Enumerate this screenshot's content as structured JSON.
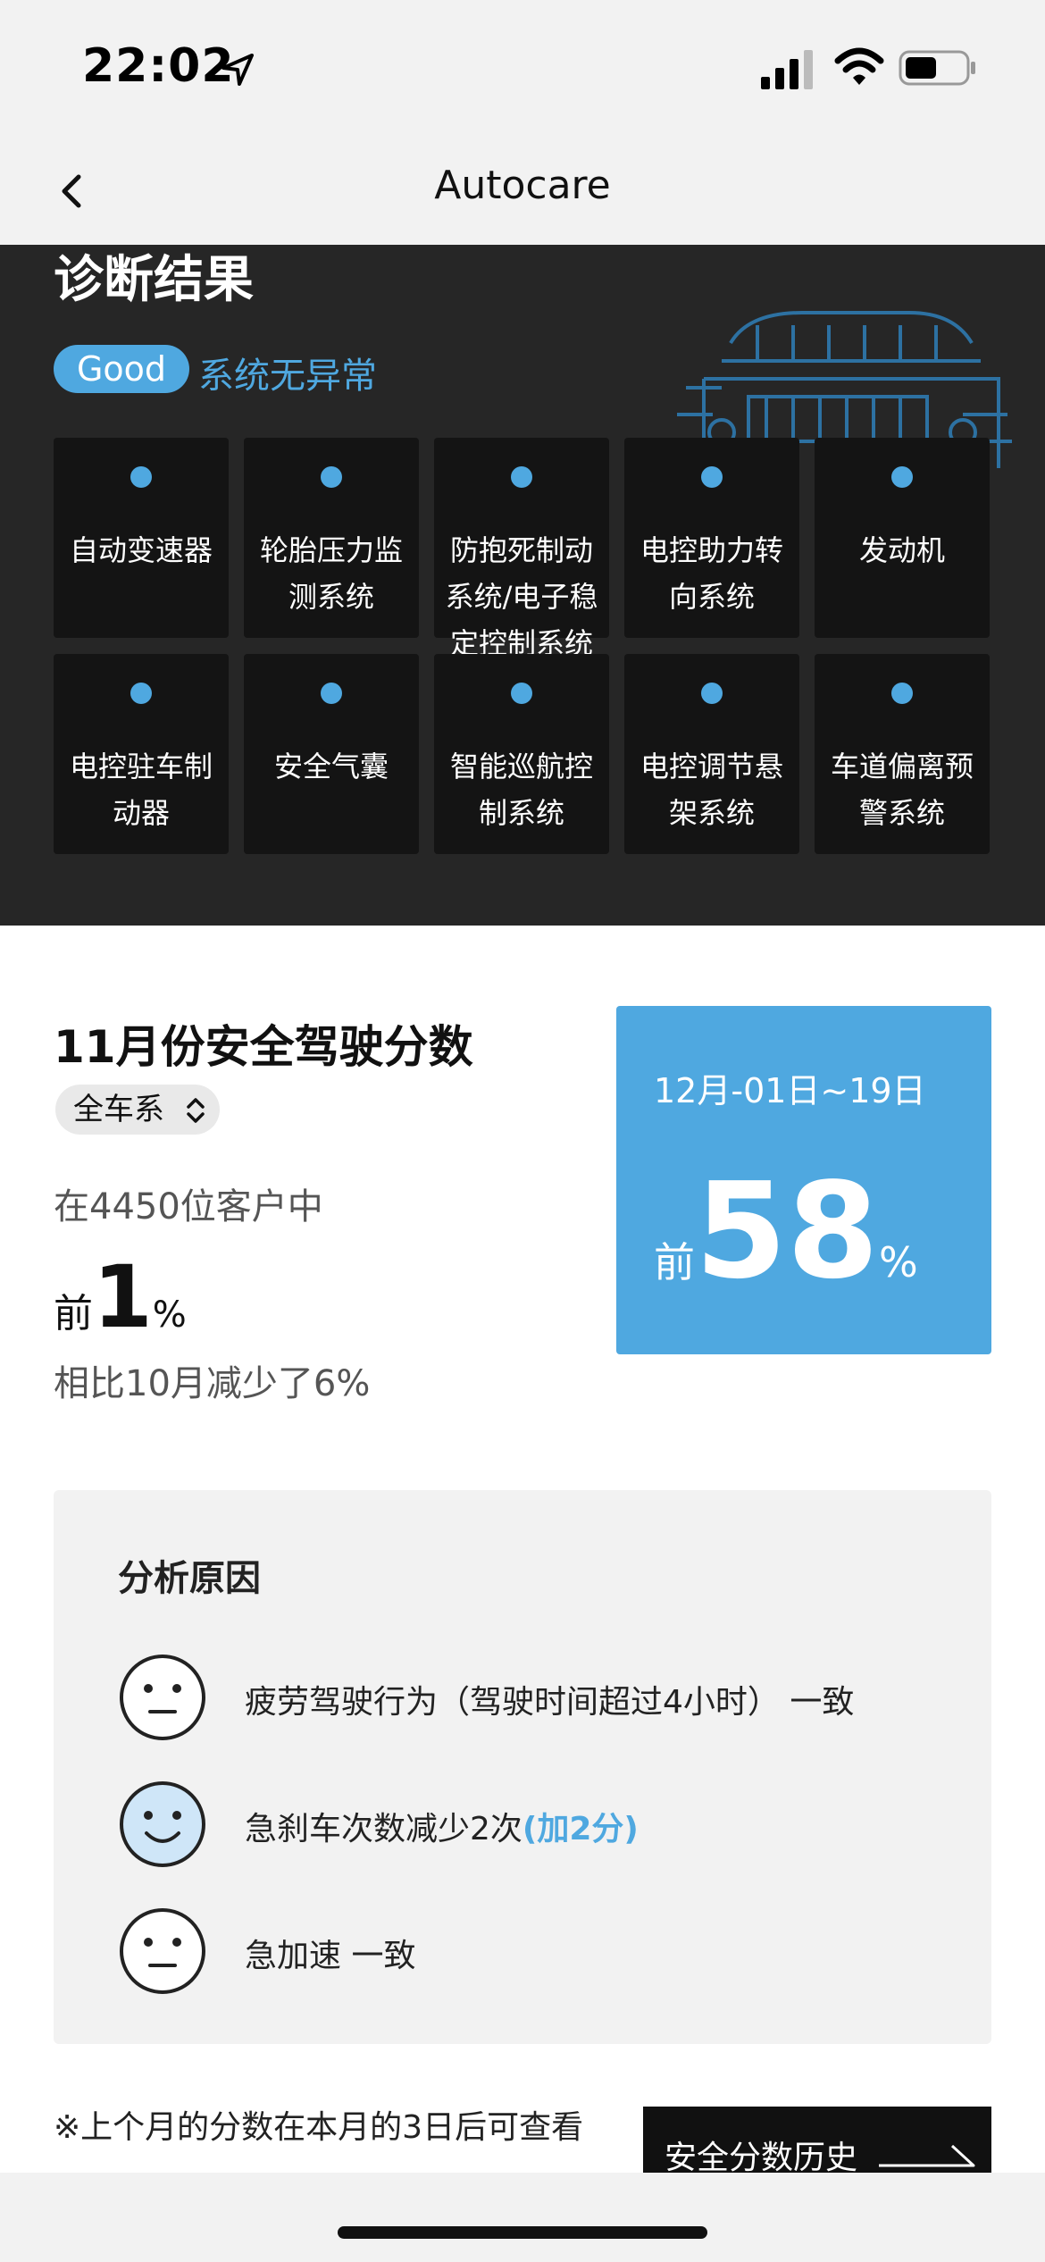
{
  "status_bar": {
    "time": "22:02",
    "icons": [
      "location-arrow-icon",
      "cellular-signal-icon",
      "wifi-icon",
      "battery-icon"
    ]
  },
  "nav": {
    "title": "Autocare",
    "back_icon": "chevron-left-icon"
  },
  "diagnosis": {
    "title": "诊断结果",
    "status_badge": "Good",
    "status_text": "系统无异常",
    "accent_color": "#4fa8e0",
    "systems": [
      {
        "label": "自动变速器",
        "status_color": "#4fa8e0"
      },
      {
        "label": "轮胎压力监测系统",
        "status_color": "#4fa8e0"
      },
      {
        "label": "防抱死制动系统/电子稳定控制系统",
        "status_color": "#4fa8e0"
      },
      {
        "label": "电控助力转向系统",
        "status_color": "#4fa8e0"
      },
      {
        "label": "发动机",
        "status_color": "#4fa8e0"
      },
      {
        "label": "电控驻车制动器",
        "status_color": "#4fa8e0"
      },
      {
        "label": "安全气囊",
        "status_color": "#4fa8e0"
      },
      {
        "label": "智能巡航控制系统",
        "status_color": "#4fa8e0"
      },
      {
        "label": "电控调节悬架系统",
        "status_color": "#4fa8e0"
      },
      {
        "label": "车道偏离预警系统",
        "status_color": "#4fa8e0"
      }
    ]
  },
  "score": {
    "title": "11月份安全驾驶分数",
    "scope_selector": "全车系",
    "customer_text": "在4450位客户中",
    "rank_prefix": "前",
    "rank_value": "1",
    "rank_unit": "%",
    "compare_text": "相比10月减少了6%",
    "week_card": {
      "range": "12月-01日~19日",
      "rank_prefix": "前",
      "rank_value": "58",
      "rank_unit": "%"
    }
  },
  "analysis": {
    "title": "分析原因",
    "reasons": [
      {
        "text": "疲劳驾驶行为（驾驶时间超过4小时） 一致",
        "bonus": "",
        "face": "neutral-face-icon"
      },
      {
        "text": "急刹车次数减少2次",
        "bonus": "(加2分)",
        "face": "smile-face-icon"
      },
      {
        "text": "急加速 一致",
        "bonus": "",
        "face": "neutral-face-icon"
      }
    ]
  },
  "footer": {
    "note": "※上个月的分数在本月的3日后可查看",
    "history_button": "安全分数历史"
  }
}
